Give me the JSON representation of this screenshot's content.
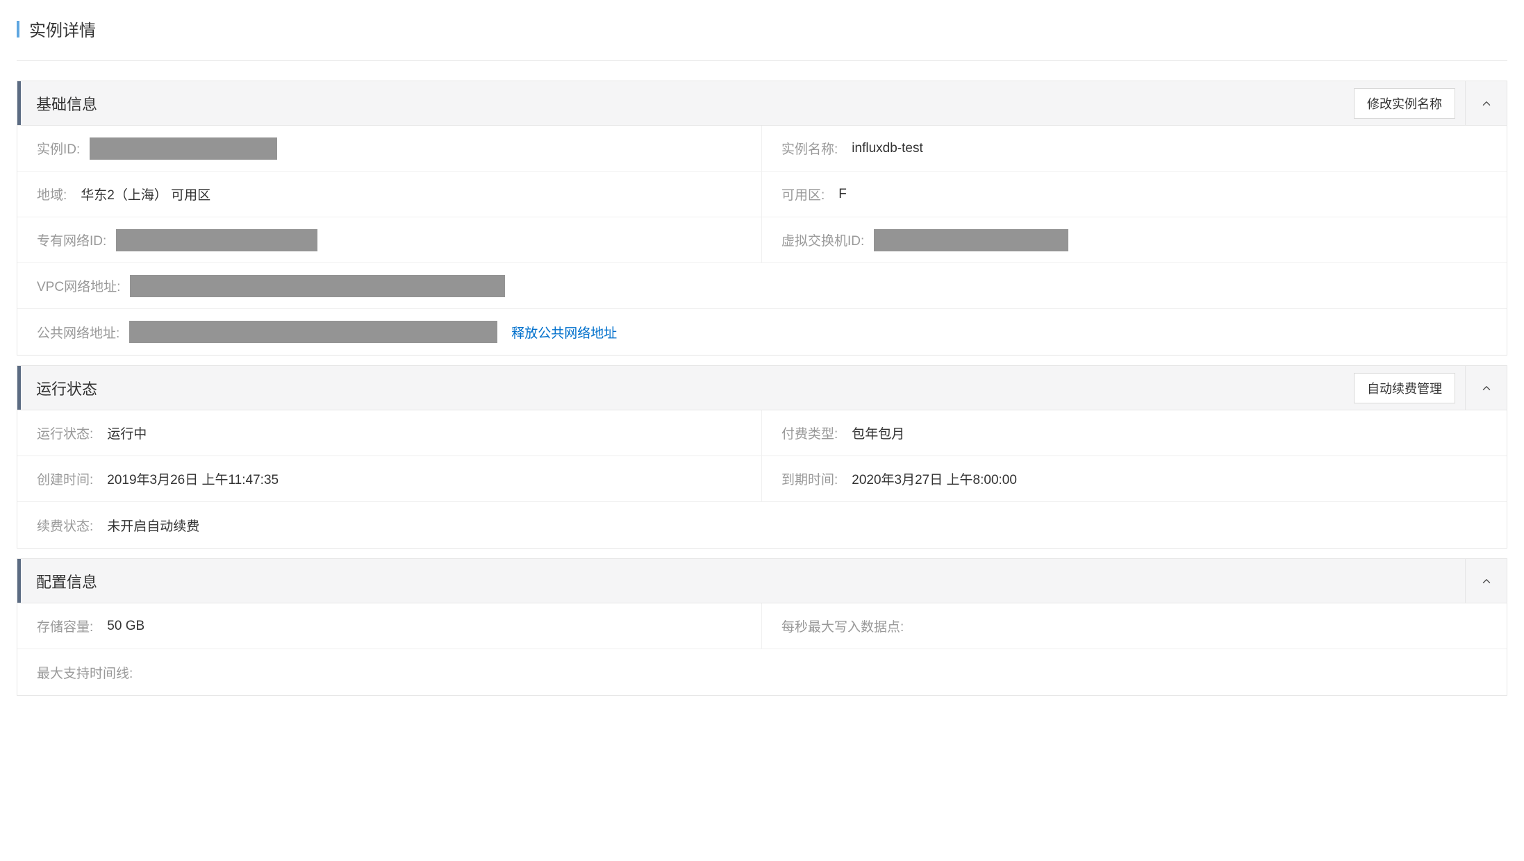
{
  "page": {
    "title": "实例详情"
  },
  "basic": {
    "title": "基础信息",
    "edit_button": "修改实例名称",
    "instance_id_label": "实例ID:",
    "instance_name_label": "实例名称:",
    "instance_name_value": "influxdb-test",
    "region_label": "地域:",
    "region_value": "华东2（上海） 可用区",
    "zone_label": "可用区:",
    "zone_value": "F",
    "vpc_id_label": "专有网络ID:",
    "vswitch_id_label": "虚拟交换机ID:",
    "vpc_addr_label": "VPC网络地址:",
    "public_addr_label": "公共网络地址:",
    "release_public_link": "释放公共网络地址"
  },
  "running": {
    "title": "运行状态",
    "renew_button": "自动续费管理",
    "status_label": "运行状态:",
    "status_value": "运行中",
    "billing_label": "付费类型:",
    "billing_value": "包年包月",
    "create_time_label": "创建时间:",
    "create_time_value": "2019年3月26日 上午11:47:35",
    "expire_time_label": "到期时间:",
    "expire_time_value": "2020年3月27日 上午8:00:00",
    "renew_status_label": "续费状态:",
    "renew_status_value": "未开启自动续费"
  },
  "config": {
    "title": "配置信息",
    "storage_label": "存储容量:",
    "storage_value": "50 GB",
    "max_write_label": "每秒最大写入数据点:",
    "max_write_value": "",
    "max_series_label": "最大支持时间线:",
    "max_series_value": ""
  }
}
